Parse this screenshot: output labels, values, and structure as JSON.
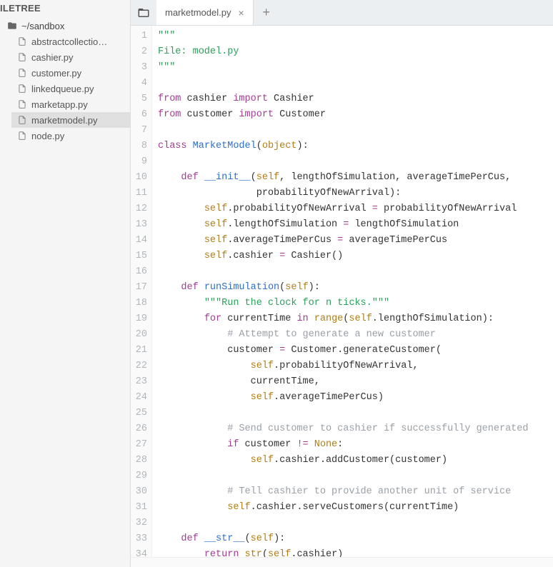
{
  "sidebar": {
    "title": "ILETREE",
    "root": "~/sandbox",
    "items": [
      {
        "label": "abstractcollectio…"
      },
      {
        "label": "cashier.py"
      },
      {
        "label": "customer.py"
      },
      {
        "label": "linkedqueue.py"
      },
      {
        "label": "marketapp.py"
      },
      {
        "label": "marketmodel.py",
        "selected": true
      },
      {
        "label": "node.py"
      }
    ]
  },
  "tabs": {
    "open": [
      {
        "label": "marketmodel.py"
      }
    ]
  },
  "code": {
    "lines": [
      [
        {
          "t": "\"\"\"",
          "c": "str"
        }
      ],
      [
        {
          "t": "File: model.py",
          "c": "str"
        }
      ],
      [
        {
          "t": "\"\"\"",
          "c": "str"
        }
      ],
      [],
      [
        {
          "t": "from",
          "c": "kw"
        },
        {
          "t": " cashier "
        },
        {
          "t": "import",
          "c": "kw"
        },
        {
          "t": " Cashier"
        }
      ],
      [
        {
          "t": "from",
          "c": "kw"
        },
        {
          "t": " customer "
        },
        {
          "t": "import",
          "c": "kw"
        },
        {
          "t": " Customer"
        }
      ],
      [],
      [
        {
          "t": "class",
          "c": "kw"
        },
        {
          "t": " "
        },
        {
          "t": "MarketModel",
          "c": "fn"
        },
        {
          "t": "("
        },
        {
          "t": "object",
          "c": "bi"
        },
        {
          "t": "):"
        }
      ],
      [],
      [
        {
          "t": "    "
        },
        {
          "t": "def",
          "c": "kw"
        },
        {
          "t": " "
        },
        {
          "t": "__init__",
          "c": "fn"
        },
        {
          "t": "("
        },
        {
          "t": "self",
          "c": "bi"
        },
        {
          "t": ", lengthOfSimulation, averageTimePerCus,"
        }
      ],
      [
        {
          "t": "                 probabilityOfNewArrival):"
        }
      ],
      [
        {
          "t": "        "
        },
        {
          "t": "self",
          "c": "bi"
        },
        {
          "t": ".probabilityOfNewArrival "
        },
        {
          "t": "=",
          "c": "op"
        },
        {
          "t": " probabilityOfNewArrival"
        }
      ],
      [
        {
          "t": "        "
        },
        {
          "t": "self",
          "c": "bi"
        },
        {
          "t": ".lengthOfSimulation "
        },
        {
          "t": "=",
          "c": "op"
        },
        {
          "t": " lengthOfSimulation"
        }
      ],
      [
        {
          "t": "        "
        },
        {
          "t": "self",
          "c": "bi"
        },
        {
          "t": ".averageTimePerCus "
        },
        {
          "t": "=",
          "c": "op"
        },
        {
          "t": " averageTimePerCus"
        }
      ],
      [
        {
          "t": "        "
        },
        {
          "t": "self",
          "c": "bi"
        },
        {
          "t": ".cashier "
        },
        {
          "t": "=",
          "c": "op"
        },
        {
          "t": " Cashier()"
        }
      ],
      [],
      [
        {
          "t": "    "
        },
        {
          "t": "def",
          "c": "kw"
        },
        {
          "t": " "
        },
        {
          "t": "runSimulation",
          "c": "fn"
        },
        {
          "t": "("
        },
        {
          "t": "self",
          "c": "bi"
        },
        {
          "t": "):"
        }
      ],
      [
        {
          "t": "        "
        },
        {
          "t": "\"\"\"Run the clock for n ticks.\"\"\"",
          "c": "str"
        }
      ],
      [
        {
          "t": "        "
        },
        {
          "t": "for",
          "c": "kw"
        },
        {
          "t": " currentTime "
        },
        {
          "t": "in",
          "c": "kw"
        },
        {
          "t": " "
        },
        {
          "t": "range",
          "c": "bi"
        },
        {
          "t": "("
        },
        {
          "t": "self",
          "c": "bi"
        },
        {
          "t": ".lengthOfSimulation):"
        }
      ],
      [
        {
          "t": "            "
        },
        {
          "t": "# Attempt to generate a new customer",
          "c": "cm"
        }
      ],
      [
        {
          "t": "            customer "
        },
        {
          "t": "=",
          "c": "op"
        },
        {
          "t": " Customer.generateCustomer("
        }
      ],
      [
        {
          "t": "                "
        },
        {
          "t": "self",
          "c": "bi"
        },
        {
          "t": ".probabilityOfNewArrival,"
        }
      ],
      [
        {
          "t": "                currentTime,"
        }
      ],
      [
        {
          "t": "                "
        },
        {
          "t": "self",
          "c": "bi"
        },
        {
          "t": ".averageTimePerCus)"
        }
      ],
      [],
      [
        {
          "t": "            "
        },
        {
          "t": "# Send customer to cashier if successfully generated",
          "c": "cm"
        }
      ],
      [
        {
          "t": "            "
        },
        {
          "t": "if",
          "c": "kw"
        },
        {
          "t": " customer "
        },
        {
          "t": "!=",
          "c": "op"
        },
        {
          "t": " "
        },
        {
          "t": "None",
          "c": "bi"
        },
        {
          "t": ":"
        }
      ],
      [
        {
          "t": "                "
        },
        {
          "t": "self",
          "c": "bi"
        },
        {
          "t": ".cashier.addCustomer(customer)"
        }
      ],
      [],
      [
        {
          "t": "            "
        },
        {
          "t": "# Tell cashier to provide another unit of service",
          "c": "cm"
        }
      ],
      [
        {
          "t": "            "
        },
        {
          "t": "self",
          "c": "bi"
        },
        {
          "t": ".cashier.serveCustomers(currentTime)"
        }
      ],
      [],
      [
        {
          "t": "    "
        },
        {
          "t": "def",
          "c": "kw"
        },
        {
          "t": " "
        },
        {
          "t": "__str__",
          "c": "fn"
        },
        {
          "t": "("
        },
        {
          "t": "self",
          "c": "bi"
        },
        {
          "t": "):"
        }
      ],
      [
        {
          "t": "        "
        },
        {
          "t": "return",
          "c": "kw"
        },
        {
          "t": " "
        },
        {
          "t": "str",
          "c": "bi"
        },
        {
          "t": "("
        },
        {
          "t": "self",
          "c": "bi"
        },
        {
          "t": ".cashier)"
        }
      ]
    ]
  }
}
